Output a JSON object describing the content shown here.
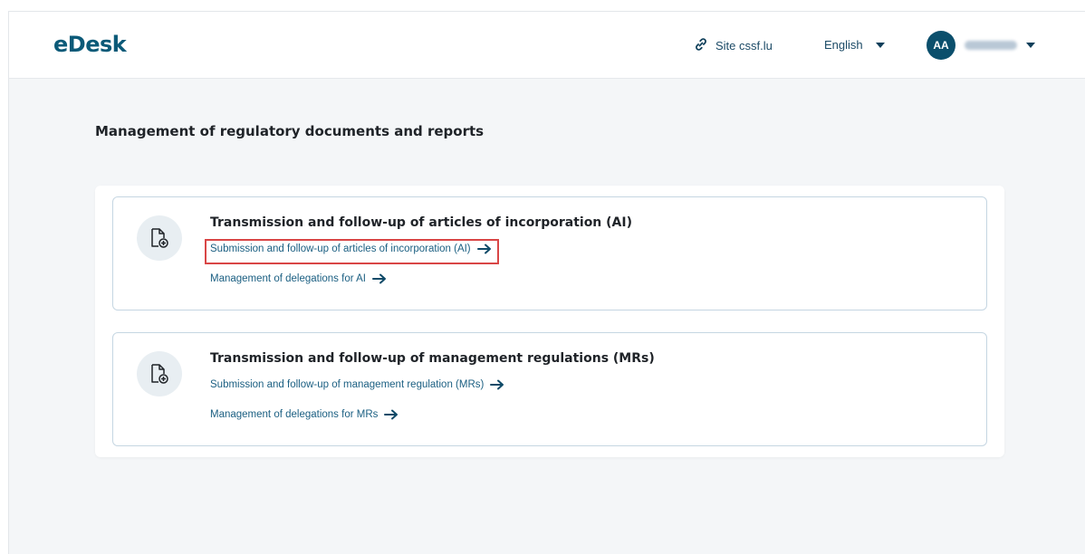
{
  "app": {
    "logo": "eDesk"
  },
  "header": {
    "site_link": "Site cssf.lu",
    "language": "English",
    "avatar_initials": "AA"
  },
  "main": {
    "title": "Management of regulatory documents and reports",
    "cards": [
      {
        "title": "Transmission and follow-up of articles of incorporation (AI)",
        "links": [
          "Submission and follow-up of articles of incorporation (AI)",
          "Management of delegations for AI"
        ]
      },
      {
        "title": "Transmission and follow-up of management regulations (MRs)",
        "links": [
          "Submission and follow-up of management regulation (MRs)",
          "Management of delegations for MRs"
        ]
      }
    ]
  },
  "colors": {
    "brand": "#0b5a78",
    "link": "#1b5f82",
    "highlight": "#d94646"
  },
  "icons": [
    "link-icon",
    "chevron-down-icon",
    "document-add-icon",
    "arrow-right-icon"
  ]
}
